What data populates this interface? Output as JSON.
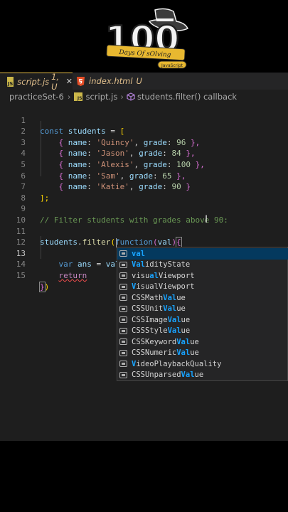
{
  "logo": {
    "number": "100",
    "subtitle": "Days Of sOlving",
    "badge": "JavaScript"
  },
  "tabs": [
    {
      "label": "script.js",
      "status": "1, U",
      "close": "✕",
      "icon": "JS"
    },
    {
      "label": "index.html",
      "status": "U"
    }
  ],
  "breadcrumb": {
    "folder": "practiceSet-6",
    "file": "script.js",
    "symbol": "students.filter() callback",
    "file_icon": "JS"
  },
  "line_numbers": [
    "1",
    "2",
    "3",
    "4",
    "5",
    "6",
    "7",
    "8",
    "9",
    "10",
    "11",
    "12",
    "13",
    "14",
    "15"
  ],
  "code": {
    "l1": {
      "kw": "const",
      "name": "students",
      "eq": " = ",
      "br": "["
    },
    "students": [
      {
        "name": "'Quincy'",
        "grade": "96",
        "tail": " },"
      },
      {
        "name": "'Jason'",
        "grade": "84",
        "tail": " },"
      },
      {
        "name": "'Alexis'",
        "grade": "100",
        "tail": " },"
      },
      {
        "name": "'Sam'",
        "grade": "65",
        "tail": " },"
      },
      {
        "name": "'Katie'",
        "grade": "90",
        "tail": " }"
      }
    ],
    "keys": {
      "name": "name",
      "grade": "grade",
      "colon": ": ",
      "comma": ", ",
      "open": "{ "
    },
    "l7": "];",
    "l9": "// Filter students with grades above 90:",
    "l11": {
      "obj": "students",
      "dot": ".",
      "method": "filter",
      "open": "(",
      "fn": "function",
      "paren": "(",
      "param": "val",
      "close": ")",
      "brace": "{"
    },
    "l13": {
      "kw": "var",
      "name": "ans",
      "eq": " = ",
      "typed": "val"
    },
    "l14": "return",
    "l15": {
      "brace": "}",
      "paren": ")"
    }
  },
  "suggestions": [
    {
      "match": "val",
      "rest": "",
      "pre": ""
    },
    {
      "pre": "",
      "match": "Val",
      "rest": "idityState"
    },
    {
      "pre": "visu",
      "match": "al",
      "rest": "Viewport"
    },
    {
      "pre": "",
      "match": "V",
      "rest": "isualViewport"
    },
    {
      "pre": "CSSMath",
      "match": "Val",
      "rest": "ue"
    },
    {
      "pre": "CSSUnit",
      "match": "Val",
      "rest": "ue"
    },
    {
      "pre": "CSSImage",
      "match": "Val",
      "rest": "ue"
    },
    {
      "pre": "CSSStyle",
      "match": "Val",
      "rest": "ue"
    },
    {
      "pre": "CSSKeyword",
      "match": "Val",
      "rest": "ue"
    },
    {
      "pre": "CSSNumeric",
      "match": "Val",
      "rest": "ue"
    },
    {
      "pre": "",
      "match": "V",
      "rest": "ideoPlaybackQuality"
    },
    {
      "pre": "CSSUnparsed",
      "match": "Val",
      "rest": "ue"
    }
  ],
  "colors": {
    "accent": "#04395e",
    "match": "#18a3ff",
    "error": "#f14c4c"
  }
}
